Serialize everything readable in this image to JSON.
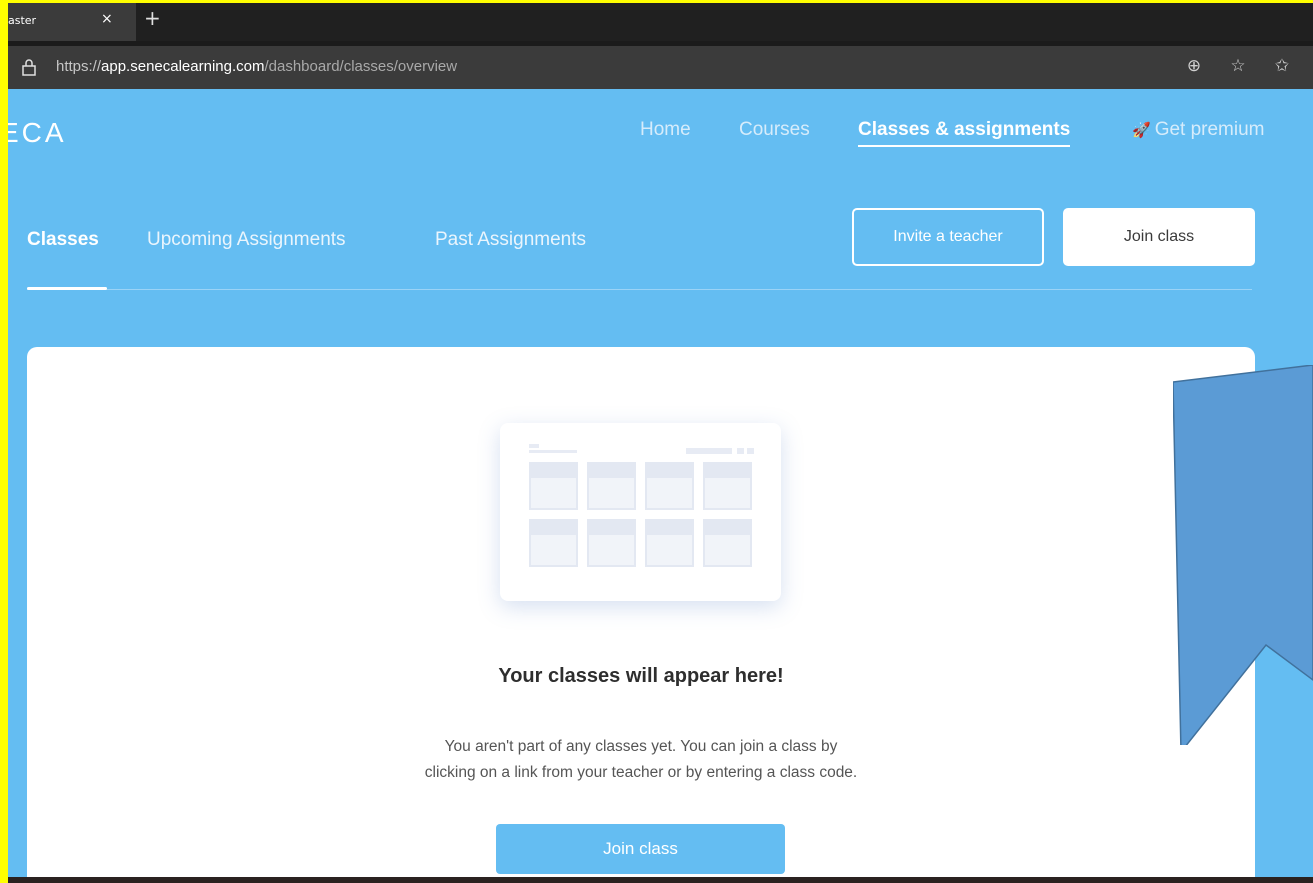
{
  "browser": {
    "tab_title": "aster",
    "tab_close": "×",
    "new_tab": "+",
    "url_scheme": "https://",
    "url_host": "app.senecalearning.com",
    "url_path": "/dashboard/classes/overview",
    "icons": [
      "lock-icon",
      "add-circle-icon",
      "star-icon",
      "favorites-icon"
    ]
  },
  "header": {
    "logo": "ECA",
    "nav": {
      "home": "Home",
      "courses": "Courses",
      "classes": "Classes & assignments",
      "premium": "Get premium"
    }
  },
  "subnav": {
    "classes": "Classes",
    "upcoming": "Upcoming Assignments",
    "past": "Past Assignments"
  },
  "actions": {
    "invite": "Invite a teacher",
    "join": "Join class"
  },
  "empty_state": {
    "title": "Your classes will appear here!",
    "line1": "You aren't part of any classes yet. You can join a class by",
    "line2": "clicking on a link from your teacher or by entering a class code.",
    "button": "Join class"
  },
  "colors": {
    "brand_blue": "#64bdf2",
    "frame": "#ffff00",
    "annotation": "#5b9bd5"
  }
}
